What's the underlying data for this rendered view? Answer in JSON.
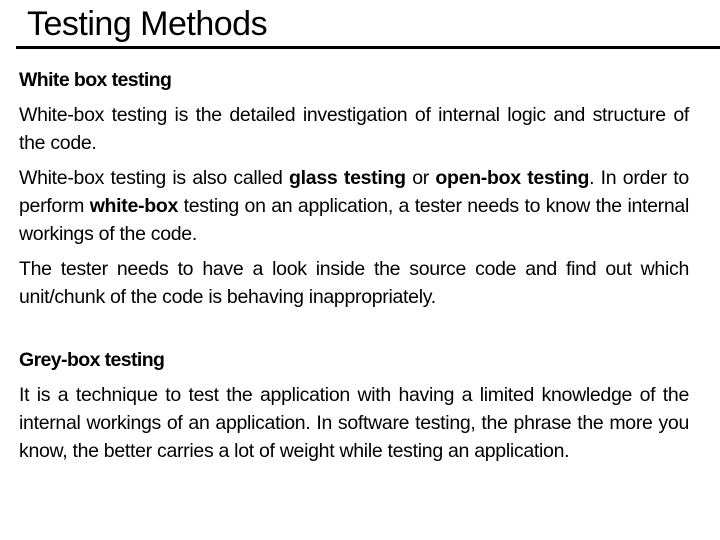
{
  "slide": {
    "title": "Testing Methods",
    "sections": [
      {
        "heading": "White box testing",
        "p1": "White-box testing is the detailed investigation of internal logic and structure of the code.",
        "p2_a": "White-box testing is also called ",
        "p2_b": "glass testing",
        "p2_c": " or ",
        "p2_d": "open-box testing",
        "p2_e": ". In order to perform ",
        "p2_f": "white-box",
        "p2_g": " testing on an application, a tester needs to know the internal workings of the code.",
        "p3": "The tester needs to have a look inside the source code and find out which unit/chunk of the code is behaving inappropriately."
      },
      {
        "heading": "Grey-box testing",
        "p1": "It is a technique to test the application with having a limited knowledge of the internal workings of an application. In software testing, the phrase the more you know, the better carries a lot of weight while testing an application."
      }
    ]
  }
}
